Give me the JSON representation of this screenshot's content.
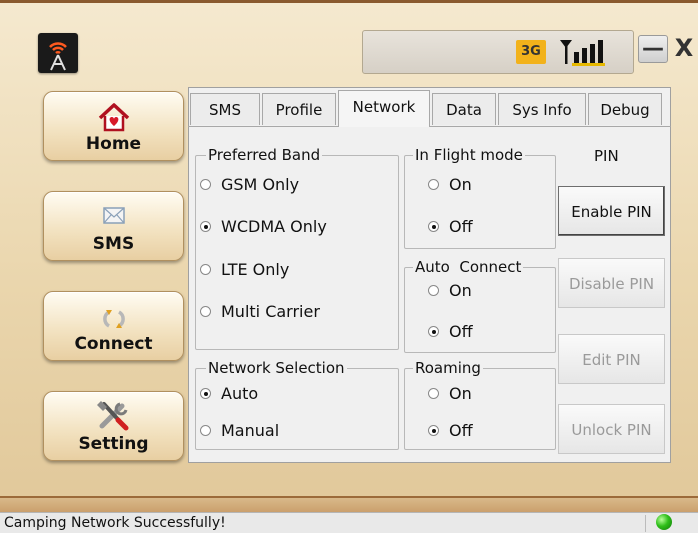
{
  "header": {
    "app_icon": "tower-antenna-icon",
    "network_type": "3G",
    "signal_icon": "signal-strength-icon",
    "minimize_label": "—",
    "close_label": "X"
  },
  "nav": [
    {
      "label": "Home",
      "icon": "home-icon"
    },
    {
      "label": "SMS",
      "icon": "envelope-icon"
    },
    {
      "label": "Connect",
      "icon": "refresh-icon"
    },
    {
      "label": "Setting",
      "icon": "tools-icon"
    }
  ],
  "tabs": [
    {
      "label": "SMS",
      "active": false
    },
    {
      "label": "Profile",
      "active": false
    },
    {
      "label": "Network",
      "active": true
    },
    {
      "label": "Data",
      "active": false
    },
    {
      "label": "Sys Info",
      "active": false
    },
    {
      "label": "Debug",
      "active": false
    }
  ],
  "preferred_band": {
    "title": "Preferred Band",
    "options": [
      {
        "label": "GSM Only",
        "selected": false
      },
      {
        "label": "WCDMA Only",
        "selected": true
      },
      {
        "label": "LTE Only",
        "selected": false
      },
      {
        "label": "Multi Carrier",
        "selected": false
      }
    ]
  },
  "network_selection": {
    "title": "Network Selection",
    "options": [
      {
        "label": "Auto",
        "selected": true
      },
      {
        "label": "Manual",
        "selected": false
      }
    ]
  },
  "flight_mode": {
    "title": "In Flight mode",
    "options": [
      {
        "label": "On",
        "selected": false
      },
      {
        "label": "Off",
        "selected": true
      }
    ]
  },
  "auto_connect": {
    "title": "Auto  Connect",
    "options": [
      {
        "label": "On",
        "selected": false
      },
      {
        "label": "Off",
        "selected": true
      }
    ]
  },
  "roaming": {
    "title": "Roaming",
    "options": [
      {
        "label": "On",
        "selected": false
      },
      {
        "label": "Off",
        "selected": true
      }
    ]
  },
  "pin": {
    "title": "PIN",
    "buttons": [
      {
        "label": "Enable PIN",
        "enabled": true
      },
      {
        "label": "Disable PIN",
        "enabled": false
      },
      {
        "label": "Edit PIN",
        "enabled": false
      },
      {
        "label": "Unlock PIN",
        "enabled": false
      }
    ]
  },
  "status": {
    "text": "Camping Network Successfully!",
    "indicator_color": "#2fbf1a"
  }
}
